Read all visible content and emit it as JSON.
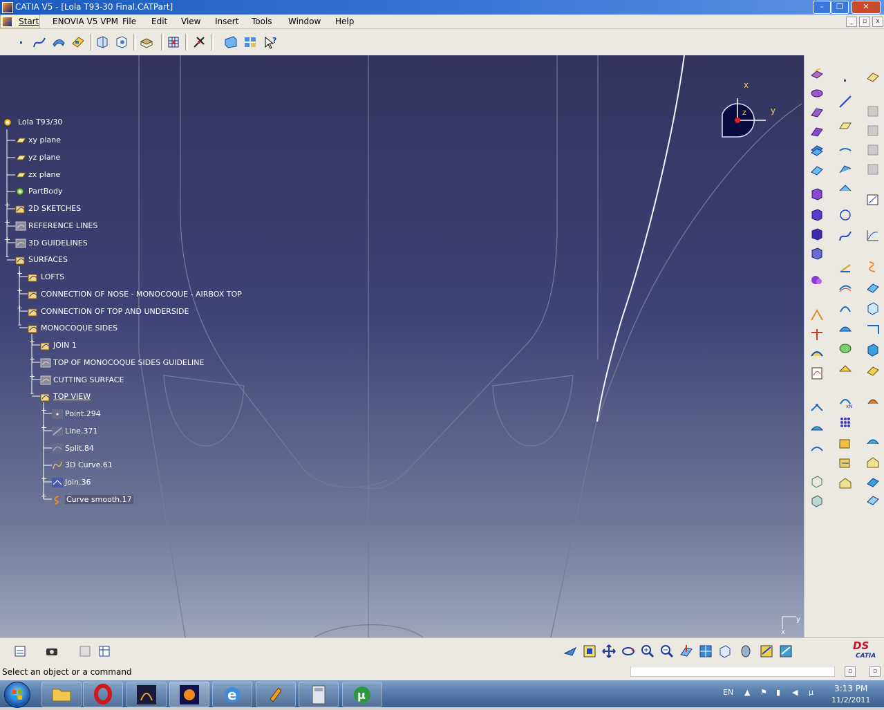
{
  "window": {
    "title": "CATIA V5 - [Lola T93-30 Final.CATPart]",
    "minimize": "–",
    "maximize": "❐",
    "close": "✕"
  },
  "menu": {
    "items": [
      "Start",
      "ENOVIA V5 VPM",
      "File",
      "Edit",
      "View",
      "Insert",
      "Tools",
      "Window",
      "Help"
    ]
  },
  "tree": {
    "root": "Lola T93/30",
    "xy": "xy plane",
    "yz": "yz plane",
    "zx": "zx plane",
    "partbody": "PartBody",
    "sketches": "2D SKETCHES",
    "reflines": "REFERENCE LINES",
    "guidelines": "3D GUIDELINES",
    "surfaces": "SURFACES",
    "lofts": "LOFTS",
    "connection_nose": "CONNECTION OF NOSE - MONOCOQUE - AIRBOX TOP",
    "connection_top": "CONNECTION OF TOP AND UNDERSIDE",
    "mono_sides": "MONOCOQUE SIDES",
    "join1": "JOIN 1",
    "top_guideline": "TOP OF MONOCOQUE SIDES GUIDELINE",
    "cutting": "CUTTING SURFACE",
    "top_view": "TOP VIEW",
    "point": "Point.294",
    "line": "Line.371",
    "split": "Split.84",
    "curve3d": "3D Curve.61",
    "join36": "Join.36",
    "curvesmooth": "Curve smooth.17"
  },
  "compass": {
    "x": "x",
    "y": "y",
    "z": "z"
  },
  "axis_small": {
    "y": "y",
    "x": "x"
  },
  "status": {
    "message": "Select an object or a command"
  },
  "taskbar": {
    "lang": "EN",
    "time": "3:13 PM",
    "date": "11/2/2011"
  },
  "brand": {
    "catia": "CATIA",
    "ds": "DS"
  },
  "colors": {
    "viewport_top": "#33335e",
    "viewport_bottom": "#9fa6bd",
    "titlebar": "#2a68cf",
    "toolbar": "#ece9e3"
  }
}
